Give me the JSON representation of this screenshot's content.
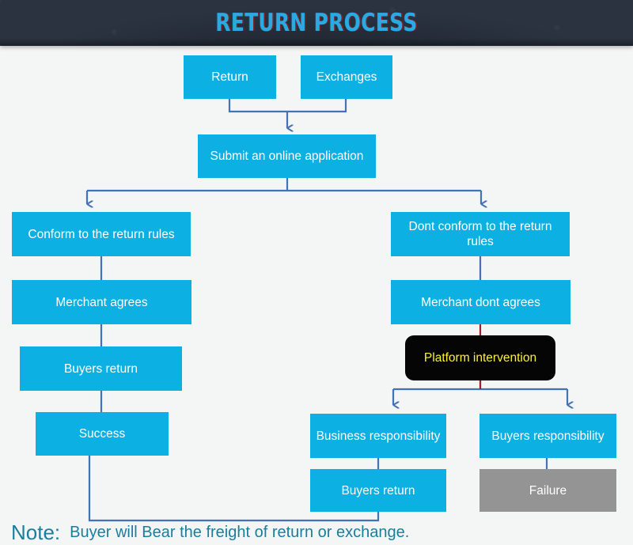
{
  "header": {
    "title": "RETURN PROCESS",
    "background_color": "#2b3341",
    "title_color": "#29abe2"
  },
  "palette": {
    "node_blue": "#0cb0e3",
    "node_gray": "#949494",
    "node_black": "#050505",
    "node_black_text": "#fbf22e",
    "connector_blue": "#4472b8",
    "connector_red": "#9e1f28",
    "canvas_background": "#f4f5f5",
    "note_text_color": "#1a7e9e"
  },
  "nodes": {
    "return": {
      "label": "Return",
      "style": "blue"
    },
    "exchanges": {
      "label": "Exchanges",
      "style": "blue"
    },
    "submit_application": {
      "label": "Submit an online application",
      "style": "blue"
    },
    "conform_rules": {
      "label": "Conform to the return rules",
      "style": "blue"
    },
    "merchant_agrees": {
      "label": "Merchant agrees",
      "style": "blue"
    },
    "buyers_return_left": {
      "label": "Buyers return",
      "style": "blue"
    },
    "success": {
      "label": "Success",
      "style": "blue"
    },
    "dont_conform_rules": {
      "label": "Dont conform to the return rules",
      "style": "blue"
    },
    "merchant_dont_agrees": {
      "label": "Merchant dont agrees",
      "style": "blue"
    },
    "platform_intervention": {
      "label": "Platform intervention",
      "style": "black"
    },
    "business_responsibility": {
      "label": "Business responsibility",
      "style": "blue"
    },
    "buyers_return_right": {
      "label": "Buyers return",
      "style": "blue"
    },
    "buyers_responsibility": {
      "label": "Buyers responsibility",
      "style": "blue"
    },
    "failure": {
      "label": "Failure",
      "style": "gray"
    }
  },
  "note": {
    "label": "Note:",
    "text": "Buyer will Bear the freight of return or exchange."
  },
  "chart_data": {
    "type": "diagram",
    "title": "RETURN PROCESS",
    "diagram_kind": "flowchart",
    "direction": "top-to-bottom",
    "node_list": [
      "Return",
      "Exchanges",
      "Submit an online application",
      "Conform to the return rules",
      "Dont conform to the return rules",
      "Merchant agrees",
      "Merchant dont agrees",
      "Buyers return",
      "Platform intervention",
      "Success",
      "Business responsibility",
      "Buyers responsibility",
      "Buyers return",
      "Failure"
    ],
    "edges": [
      {
        "from": "Return",
        "to": "Submit an online application"
      },
      {
        "from": "Exchanges",
        "to": "Submit an online application"
      },
      {
        "from": "Submit an online application",
        "to": "Conform to the return rules"
      },
      {
        "from": "Submit an online application",
        "to": "Dont conform to the return rules"
      },
      {
        "from": "Conform to the return rules",
        "to": "Merchant agrees"
      },
      {
        "from": "Merchant agrees",
        "to": "Buyers return"
      },
      {
        "from": "Buyers return",
        "to": "Success"
      },
      {
        "from": "Dont conform to the return rules",
        "to": "Merchant dont agrees"
      },
      {
        "from": "Merchant dont agrees",
        "to": "Platform intervention"
      },
      {
        "from": "Platform intervention",
        "to": "Business responsibility"
      },
      {
        "from": "Platform intervention",
        "to": "Buyers responsibility"
      },
      {
        "from": "Business responsibility",
        "to": "Buyers return"
      },
      {
        "from": "Buyers responsibility",
        "to": "Failure"
      },
      {
        "from": "Buyers return",
        "to": "Success"
      }
    ]
  }
}
